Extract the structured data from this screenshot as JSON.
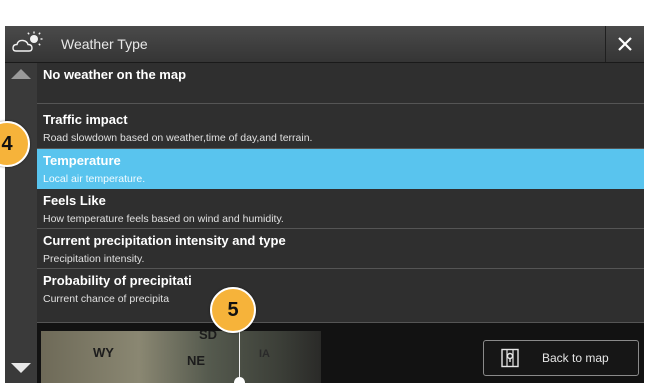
{
  "dialog": {
    "title": "Weather Type",
    "title_icon": "cloud-sun-icon",
    "close_icon": "close-icon"
  },
  "options": [
    {
      "title": "No weather on the map",
      "subtitle": "",
      "selected": false
    },
    {
      "title": "Traffic impact",
      "subtitle": "Road slowdown based on weather,time of day,and terrain.",
      "selected": false
    },
    {
      "title": "Temperature",
      "subtitle": "Local air temperature.",
      "selected": true
    },
    {
      "title": "Feels Like",
      "subtitle": "How temperature feels based on wind and humidity.",
      "selected": false
    },
    {
      "title": "Current precipitation intensity and type",
      "subtitle": "Precipitation intensity.",
      "selected": false
    },
    {
      "title": "Probability of precipitati",
      "subtitle": "Current chance of precipita",
      "selected": false
    }
  ],
  "map": {
    "labels": [
      "WY",
      "NE",
      "SD",
      "IA"
    ]
  },
  "back_button": {
    "label": "Back to map",
    "icon": "map-pin-icon"
  },
  "callouts": [
    "4",
    "5"
  ],
  "colors": {
    "selected_row": "#59c4ee",
    "badge": "#f6b33a",
    "panel": "#2a2a2a"
  }
}
